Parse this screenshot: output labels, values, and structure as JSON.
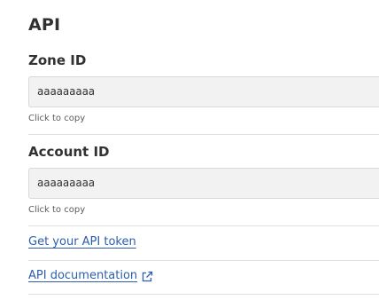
{
  "api": {
    "title": "API",
    "zone": {
      "label": "Zone ID",
      "value": "aaaaaaaaa",
      "hint": "Click to copy"
    },
    "account": {
      "label": "Account ID",
      "value": "aaaaaaaaa",
      "hint": "Click to copy"
    },
    "links": {
      "token": "Get your API token",
      "docs": "API documentation"
    }
  },
  "icons": {
    "external": "external-link-icon"
  },
  "colors": {
    "link": "#2c5eaa",
    "field_bg": "#f2f2f2",
    "divider": "#e0e0e0"
  }
}
